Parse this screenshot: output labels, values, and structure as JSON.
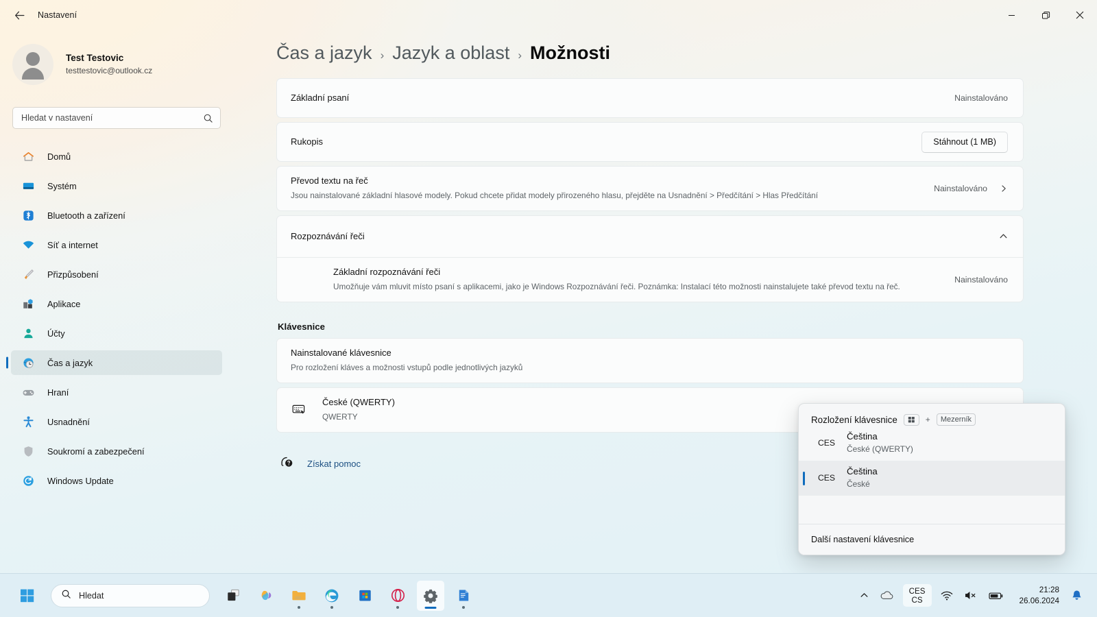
{
  "window": {
    "title": "Nastavení",
    "back_icon": "back-arrow-icon",
    "minimize_icon": "minimize-icon",
    "maximize_icon": "maximize-icon",
    "close_icon": "close-icon"
  },
  "account": {
    "name": "Test Testovic",
    "email": "testtestovic@outlook.cz",
    "avatar_icon": "user-avatar-icon"
  },
  "search": {
    "placeholder": "Hledat v nastavení",
    "value": "",
    "icon": "search-icon"
  },
  "sidebar": {
    "items": [
      {
        "label": "Domů",
        "icon": "home-icon",
        "active": false
      },
      {
        "label": "Systém",
        "icon": "system-icon",
        "active": false
      },
      {
        "label": "Bluetooth a zařízení",
        "icon": "bluetooth-icon",
        "active": false
      },
      {
        "label": "Síť a internet",
        "icon": "wifi-icon",
        "active": false
      },
      {
        "label": "Přizpůsobení",
        "icon": "brush-icon",
        "active": false
      },
      {
        "label": "Aplikace",
        "icon": "apps-icon",
        "active": false
      },
      {
        "label": "Účty",
        "icon": "accounts-icon",
        "active": false
      },
      {
        "label": "Čas a jazyk",
        "icon": "clock-globe-icon",
        "active": true
      },
      {
        "label": "Hraní",
        "icon": "gamepad-icon",
        "active": false
      },
      {
        "label": "Usnadnění",
        "icon": "accessibility-icon",
        "active": false
      },
      {
        "label": "Soukromí a zabezpečení",
        "icon": "shield-icon",
        "active": false
      },
      {
        "label": "Windows Update",
        "icon": "update-icon",
        "active": false
      }
    ]
  },
  "breadcrumb": {
    "crumb1": "Čas a jazyk",
    "sep1": "›",
    "crumb2": "Jazyk a oblast",
    "sep2": "›",
    "current": "Možnosti"
  },
  "main": {
    "basic_typing": {
      "title": "Základní psaní",
      "status": "Nainstalováno"
    },
    "handwriting": {
      "title": "Rukopis",
      "button": "Stáhnout (1 MB)"
    },
    "text_to_speech": {
      "title": "Převod textu na řeč",
      "description": "Jsou nainstalované základní hlasové modely. Pokud chcete přidat modely přirozeného hlasu, přejděte na Usnadnění > Předčítání > Hlas Předčítání",
      "status": "Nainstalováno",
      "chevron_icon": "chevron-right-icon"
    },
    "speech_recognition": {
      "title": "Rozpoznávání řeči",
      "chevron_icon": "chevron-up-icon",
      "child": {
        "title": "Základní rozpoznávání řeči",
        "description": "Umožňuje vám mluvit místo psaní s aplikacemi, jako je Windows Rozpoznávání řeči. Poznámka: Instalací této možnosti nainstalujete také převod textu na řeč.",
        "status": "Nainstalováno"
      }
    },
    "keyboard_section": {
      "heading": "Klávesnice",
      "installed": {
        "title": "Nainstalované klávesnice",
        "description": "Pro rozložení kláves a možnosti vstupů podle jednotlivých jazyků"
      },
      "layout_row": {
        "title": "České (QWERTY)",
        "subtitle": "QWERTY",
        "icon": "keyboard-icon"
      }
    },
    "help": {
      "label": "Získat pomoc",
      "icon": "help-icon"
    }
  },
  "keyboard_flyout": {
    "title": "Rozložení klávesnice",
    "key_win": "windows-key-icon",
    "key_plus": "+",
    "key_space": "Mezerník",
    "items": [
      {
        "code": "CES",
        "name": "Čeština",
        "variant": "České (QWERTY)",
        "selected": false
      },
      {
        "code": "CES",
        "name": "Čeština",
        "variant": "České",
        "selected": true
      }
    ],
    "footer": "Další nastavení klávesnice"
  },
  "taskbar": {
    "start_icon": "windows-start-icon",
    "search": {
      "placeholder": "Hledat",
      "icon": "search-icon"
    },
    "apps": [
      {
        "name": "task-view-icon",
        "running": false,
        "active": false
      },
      {
        "name": "copilot-icon",
        "running": false,
        "active": false
      },
      {
        "name": "file-explorer-icon",
        "running": true,
        "active": false
      },
      {
        "name": "edge-icon",
        "running": true,
        "active": false
      },
      {
        "name": "microsoft-store-icon",
        "running": false,
        "active": false
      },
      {
        "name": "opera-icon",
        "running": true,
        "active": false
      },
      {
        "name": "settings-icon",
        "running": true,
        "active": true
      },
      {
        "name": "notepad-icon",
        "running": true,
        "active": false
      }
    ],
    "tray": {
      "chevron_icon": "tray-expand-icon",
      "cloud_icon": "onedrive-icon",
      "lang_line1": "CES",
      "lang_line2": "CS",
      "wifi_icon": "wifi-icon",
      "volume_icon": "volume-muted-icon",
      "battery_icon": "battery-icon",
      "time": "21:28",
      "date": "26.06.2024",
      "notification_icon": "bell-icon"
    }
  },
  "colors": {
    "accent": "#0f6cbd",
    "link": "#1c4f82",
    "taskbar": "#dfeef5"
  }
}
